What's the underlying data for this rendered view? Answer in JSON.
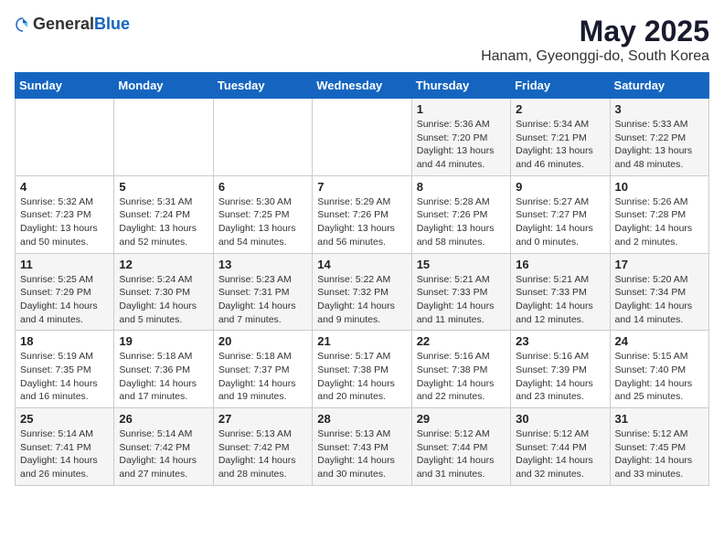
{
  "header": {
    "logo_general": "General",
    "logo_blue": "Blue",
    "main_title": "May 2025",
    "subtitle": "Hanam, Gyeonggi-do, South Korea"
  },
  "days_of_week": [
    "Sunday",
    "Monday",
    "Tuesday",
    "Wednesday",
    "Thursday",
    "Friday",
    "Saturday"
  ],
  "weeks": [
    [
      {
        "day": "",
        "info": ""
      },
      {
        "day": "",
        "info": ""
      },
      {
        "day": "",
        "info": ""
      },
      {
        "day": "",
        "info": ""
      },
      {
        "day": "1",
        "info": "Sunrise: 5:36 AM\nSunset: 7:20 PM\nDaylight: 13 hours\nand 44 minutes."
      },
      {
        "day": "2",
        "info": "Sunrise: 5:34 AM\nSunset: 7:21 PM\nDaylight: 13 hours\nand 46 minutes."
      },
      {
        "day": "3",
        "info": "Sunrise: 5:33 AM\nSunset: 7:22 PM\nDaylight: 13 hours\nand 48 minutes."
      }
    ],
    [
      {
        "day": "4",
        "info": "Sunrise: 5:32 AM\nSunset: 7:23 PM\nDaylight: 13 hours\nand 50 minutes."
      },
      {
        "day": "5",
        "info": "Sunrise: 5:31 AM\nSunset: 7:24 PM\nDaylight: 13 hours\nand 52 minutes."
      },
      {
        "day": "6",
        "info": "Sunrise: 5:30 AM\nSunset: 7:25 PM\nDaylight: 13 hours\nand 54 minutes."
      },
      {
        "day": "7",
        "info": "Sunrise: 5:29 AM\nSunset: 7:26 PM\nDaylight: 13 hours\nand 56 minutes."
      },
      {
        "day": "8",
        "info": "Sunrise: 5:28 AM\nSunset: 7:26 PM\nDaylight: 13 hours\nand 58 minutes."
      },
      {
        "day": "9",
        "info": "Sunrise: 5:27 AM\nSunset: 7:27 PM\nDaylight: 14 hours\nand 0 minutes."
      },
      {
        "day": "10",
        "info": "Sunrise: 5:26 AM\nSunset: 7:28 PM\nDaylight: 14 hours\nand 2 minutes."
      }
    ],
    [
      {
        "day": "11",
        "info": "Sunrise: 5:25 AM\nSunset: 7:29 PM\nDaylight: 14 hours\nand 4 minutes."
      },
      {
        "day": "12",
        "info": "Sunrise: 5:24 AM\nSunset: 7:30 PM\nDaylight: 14 hours\nand 5 minutes."
      },
      {
        "day": "13",
        "info": "Sunrise: 5:23 AM\nSunset: 7:31 PM\nDaylight: 14 hours\nand 7 minutes."
      },
      {
        "day": "14",
        "info": "Sunrise: 5:22 AM\nSunset: 7:32 PM\nDaylight: 14 hours\nand 9 minutes."
      },
      {
        "day": "15",
        "info": "Sunrise: 5:21 AM\nSunset: 7:33 PM\nDaylight: 14 hours\nand 11 minutes."
      },
      {
        "day": "16",
        "info": "Sunrise: 5:21 AM\nSunset: 7:33 PM\nDaylight: 14 hours\nand 12 minutes."
      },
      {
        "day": "17",
        "info": "Sunrise: 5:20 AM\nSunset: 7:34 PM\nDaylight: 14 hours\nand 14 minutes."
      }
    ],
    [
      {
        "day": "18",
        "info": "Sunrise: 5:19 AM\nSunset: 7:35 PM\nDaylight: 14 hours\nand 16 minutes."
      },
      {
        "day": "19",
        "info": "Sunrise: 5:18 AM\nSunset: 7:36 PM\nDaylight: 14 hours\nand 17 minutes."
      },
      {
        "day": "20",
        "info": "Sunrise: 5:18 AM\nSunset: 7:37 PM\nDaylight: 14 hours\nand 19 minutes."
      },
      {
        "day": "21",
        "info": "Sunrise: 5:17 AM\nSunset: 7:38 PM\nDaylight: 14 hours\nand 20 minutes."
      },
      {
        "day": "22",
        "info": "Sunrise: 5:16 AM\nSunset: 7:38 PM\nDaylight: 14 hours\nand 22 minutes."
      },
      {
        "day": "23",
        "info": "Sunrise: 5:16 AM\nSunset: 7:39 PM\nDaylight: 14 hours\nand 23 minutes."
      },
      {
        "day": "24",
        "info": "Sunrise: 5:15 AM\nSunset: 7:40 PM\nDaylight: 14 hours\nand 25 minutes."
      }
    ],
    [
      {
        "day": "25",
        "info": "Sunrise: 5:14 AM\nSunset: 7:41 PM\nDaylight: 14 hours\nand 26 minutes."
      },
      {
        "day": "26",
        "info": "Sunrise: 5:14 AM\nSunset: 7:42 PM\nDaylight: 14 hours\nand 27 minutes."
      },
      {
        "day": "27",
        "info": "Sunrise: 5:13 AM\nSunset: 7:42 PM\nDaylight: 14 hours\nand 28 minutes."
      },
      {
        "day": "28",
        "info": "Sunrise: 5:13 AM\nSunset: 7:43 PM\nDaylight: 14 hours\nand 30 minutes."
      },
      {
        "day": "29",
        "info": "Sunrise: 5:12 AM\nSunset: 7:44 PM\nDaylight: 14 hours\nand 31 minutes."
      },
      {
        "day": "30",
        "info": "Sunrise: 5:12 AM\nSunset: 7:44 PM\nDaylight: 14 hours\nand 32 minutes."
      },
      {
        "day": "31",
        "info": "Sunrise: 5:12 AM\nSunset: 7:45 PM\nDaylight: 14 hours\nand 33 minutes."
      }
    ]
  ]
}
